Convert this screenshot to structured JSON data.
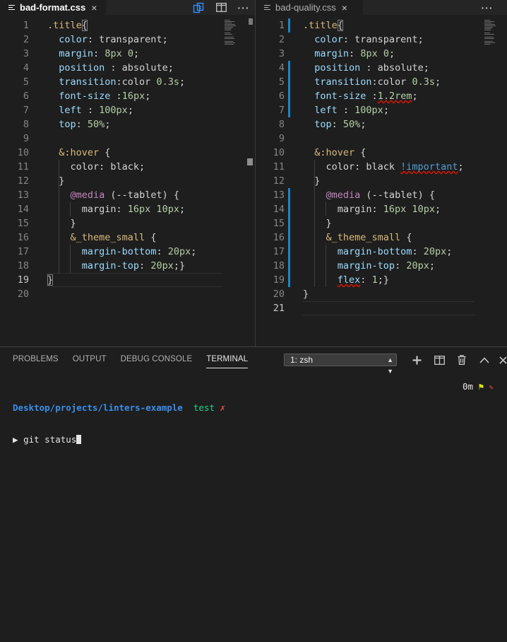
{
  "editor_left": {
    "tab": {
      "filename": "bad-format.css",
      "close": "×"
    },
    "actions": {
      "more": "···"
    },
    "lines": [
      {
        "n": "1",
        "tokens": [
          {
            "t": ".title",
            "c": "sel"
          },
          {
            "t": "{",
            "c": "pl brk"
          }
        ]
      },
      {
        "n": "2",
        "tokens": [
          {
            "t": "  "
          },
          {
            "t": "color",
            "c": "prop"
          },
          {
            "t": ": transparent;",
            "c": "pl"
          }
        ]
      },
      {
        "n": "3",
        "tokens": [
          {
            "t": "  "
          },
          {
            "t": "margin",
            "c": "prop"
          },
          {
            "t": ": ",
            "c": "pl"
          },
          {
            "t": "8px 0",
            "c": "num"
          },
          {
            "t": ";",
            "c": "pl"
          }
        ]
      },
      {
        "n": "4",
        "tokens": [
          {
            "t": "  "
          },
          {
            "t": "position",
            "c": "prop"
          },
          {
            "t": " : absolute;",
            "c": "pl"
          }
        ]
      },
      {
        "n": "5",
        "tokens": [
          {
            "t": "  "
          },
          {
            "t": "transition",
            "c": "prop"
          },
          {
            "t": ":color ",
            "c": "pl"
          },
          {
            "t": "0.3s",
            "c": "num"
          },
          {
            "t": ";",
            "c": "pl"
          }
        ]
      },
      {
        "n": "6",
        "tokens": [
          {
            "t": "  "
          },
          {
            "t": "font-size",
            "c": "prop"
          },
          {
            "t": " :",
            "c": "pl"
          },
          {
            "t": "16px",
            "c": "num"
          },
          {
            "t": ";",
            "c": "pl"
          }
        ]
      },
      {
        "n": "7",
        "tokens": [
          {
            "t": "  "
          },
          {
            "t": "left",
            "c": "prop"
          },
          {
            "t": " : ",
            "c": "pl"
          },
          {
            "t": "100px",
            "c": "num"
          },
          {
            "t": ";",
            "c": "pl"
          }
        ]
      },
      {
        "n": "8",
        "tokens": [
          {
            "t": "  "
          },
          {
            "t": "top",
            "c": "prop"
          },
          {
            "t": ": ",
            "c": "pl"
          },
          {
            "t": "50%",
            "c": "num"
          },
          {
            "t": ";",
            "c": "pl"
          }
        ]
      },
      {
        "n": "9",
        "tokens": []
      },
      {
        "n": "10",
        "tokens": [
          {
            "t": "  "
          },
          {
            "t": "&:hover",
            "c": "sel"
          },
          {
            "t": " {",
            "c": "pl"
          }
        ]
      },
      {
        "n": "11",
        "tokens": [
          {
            "t": "    color: black;",
            "c": "pl"
          }
        ]
      },
      {
        "n": "12",
        "tokens": [
          {
            "t": "  }",
            "c": "pl"
          }
        ]
      },
      {
        "n": "13",
        "tokens": [
          {
            "t": "    "
          },
          {
            "t": "@media",
            "c": "kw"
          },
          {
            "t": " (--tablet) {",
            "c": "pl"
          }
        ]
      },
      {
        "n": "14",
        "tokens": [
          {
            "t": "      margin: ",
            "c": "pl"
          },
          {
            "t": "16px 10px",
            "c": "num"
          },
          {
            "t": ";",
            "c": "pl"
          }
        ]
      },
      {
        "n": "15",
        "tokens": [
          {
            "t": "    }",
            "c": "pl"
          }
        ]
      },
      {
        "n": "16",
        "tokens": [
          {
            "t": "    "
          },
          {
            "t": "&_theme_small",
            "c": "sel"
          },
          {
            "t": " {",
            "c": "pl"
          }
        ]
      },
      {
        "n": "17",
        "tokens": [
          {
            "t": "      "
          },
          {
            "t": "margin-bottom",
            "c": "prop"
          },
          {
            "t": ": ",
            "c": "pl"
          },
          {
            "t": "20px",
            "c": "num"
          },
          {
            "t": ";",
            "c": "pl"
          }
        ]
      },
      {
        "n": "18",
        "tokens": [
          {
            "t": "      "
          },
          {
            "t": "margin-top",
            "c": "prop"
          },
          {
            "t": ": ",
            "c": "pl"
          },
          {
            "t": "20px",
            "c": "num"
          },
          {
            "t": ";}",
            "c": "pl"
          }
        ]
      },
      {
        "n": "19",
        "tokens": [
          {
            "t": "}",
            "c": "pl brk"
          }
        ]
      },
      {
        "n": "20",
        "tokens": []
      }
    ]
  },
  "editor_right": {
    "tab": {
      "filename": "bad-quality.css",
      "close": "×"
    },
    "actions": {
      "more": "···"
    },
    "lines": [
      {
        "n": "1",
        "tokens": [
          {
            "t": ".title",
            "c": "sel"
          },
          {
            "t": "{",
            "c": "pl brk"
          }
        ]
      },
      {
        "n": "2",
        "tokens": [
          {
            "t": "  "
          },
          {
            "t": "color",
            "c": "prop"
          },
          {
            "t": ": transparent;",
            "c": "pl"
          }
        ]
      },
      {
        "n": "3",
        "tokens": [
          {
            "t": "  "
          },
          {
            "t": "margin",
            "c": "prop"
          },
          {
            "t": ": ",
            "c": "pl"
          },
          {
            "t": "8px 0",
            "c": "num"
          },
          {
            "t": ";",
            "c": "pl"
          }
        ]
      },
      {
        "n": "4",
        "tokens": [
          {
            "t": "  "
          },
          {
            "t": "position",
            "c": "prop"
          },
          {
            "t": " : absolute;",
            "c": "pl"
          }
        ]
      },
      {
        "n": "5",
        "tokens": [
          {
            "t": "  "
          },
          {
            "t": "transition",
            "c": "prop"
          },
          {
            "t": ":color ",
            "c": "pl"
          },
          {
            "t": "0.3s",
            "c": "num"
          },
          {
            "t": ";",
            "c": "pl"
          }
        ]
      },
      {
        "n": "6",
        "tokens": [
          {
            "t": "  "
          },
          {
            "t": "font-size",
            "c": "prop"
          },
          {
            "t": " :",
            "c": "pl"
          },
          {
            "t": "1.2rem",
            "c": "num squig"
          },
          {
            "t": ";",
            "c": "pl"
          }
        ]
      },
      {
        "n": "7",
        "tokens": [
          {
            "t": "  "
          },
          {
            "t": "left",
            "c": "prop"
          },
          {
            "t": " : ",
            "c": "pl"
          },
          {
            "t": "100px",
            "c": "num"
          },
          {
            "t": ";",
            "c": "pl"
          }
        ]
      },
      {
        "n": "8",
        "tokens": [
          {
            "t": "  "
          },
          {
            "t": "top",
            "c": "prop"
          },
          {
            "t": ": ",
            "c": "pl"
          },
          {
            "t": "50%",
            "c": "num"
          },
          {
            "t": ";",
            "c": "pl"
          }
        ]
      },
      {
        "n": "9",
        "tokens": []
      },
      {
        "n": "10",
        "tokens": [
          {
            "t": "  "
          },
          {
            "t": "&:hover",
            "c": "sel"
          },
          {
            "t": " {",
            "c": "pl"
          }
        ]
      },
      {
        "n": "11",
        "tokens": [
          {
            "t": "    color: black ",
            "c": "pl"
          },
          {
            "t": "!important",
            "c": "bri squig"
          },
          {
            "t": ";",
            "c": "pl"
          }
        ]
      },
      {
        "n": "12",
        "tokens": [
          {
            "t": "  }",
            "c": "pl"
          }
        ]
      },
      {
        "n": "13",
        "tokens": [
          {
            "t": "    "
          },
          {
            "t": "@media",
            "c": "kw"
          },
          {
            "t": " (--tablet) {",
            "c": "pl"
          }
        ]
      },
      {
        "n": "14",
        "tokens": [
          {
            "t": "      margin: ",
            "c": "pl"
          },
          {
            "t": "16px 10px",
            "c": "num"
          },
          {
            "t": ";",
            "c": "pl"
          }
        ]
      },
      {
        "n": "15",
        "tokens": [
          {
            "t": "    }",
            "c": "pl"
          }
        ]
      },
      {
        "n": "16",
        "tokens": [
          {
            "t": "    "
          },
          {
            "t": "&_theme_small",
            "c": "sel"
          },
          {
            "t": " {",
            "c": "pl"
          }
        ]
      },
      {
        "n": "17",
        "tokens": [
          {
            "t": "      "
          },
          {
            "t": "margin-bottom",
            "c": "prop"
          },
          {
            "t": ": ",
            "c": "pl"
          },
          {
            "t": "20px",
            "c": "num"
          },
          {
            "t": ";",
            "c": "pl"
          }
        ]
      },
      {
        "n": "18",
        "tokens": [
          {
            "t": "      "
          },
          {
            "t": "margin-top",
            "c": "prop"
          },
          {
            "t": ": ",
            "c": "pl"
          },
          {
            "t": "20px",
            "c": "num"
          },
          {
            "t": ";",
            "c": "pl"
          }
        ]
      },
      {
        "n": "19",
        "tokens": [
          {
            "t": "      "
          },
          {
            "t": "flex",
            "c": "prop squig"
          },
          {
            "t": ": ",
            "c": "pl"
          },
          {
            "t": "1",
            "c": "num"
          },
          {
            "t": ";}",
            "c": "pl"
          }
        ]
      },
      {
        "n": "20",
        "tokens": [
          {
            "t": "}",
            "c": "pl"
          }
        ]
      },
      {
        "n": "21",
        "tokens": []
      }
    ]
  },
  "panel": {
    "tabs": [
      "PROBLEMS",
      "OUTPUT",
      "DEBUG CONSOLE",
      "TERMINAL"
    ],
    "active_tab": "TERMINAL",
    "terminal_select": "1: zsh"
  },
  "terminal": {
    "path": "Desktop/projects/linters-example",
    "branch": "test",
    "dirty_mark": "✗",
    "prompt_symbol": "▶",
    "command": "git status",
    "right_time": "0m",
    "right_flag": "⚑",
    "right_mark": "✎"
  },
  "colors": {
    "background": "#1e1e1e",
    "selector": "#d7ba7d",
    "property": "#9cdcfe",
    "number": "#b5cea8",
    "at_rule": "#c586c0",
    "git_modified": "#1a85c4",
    "error_squiggle": "#e51400"
  }
}
